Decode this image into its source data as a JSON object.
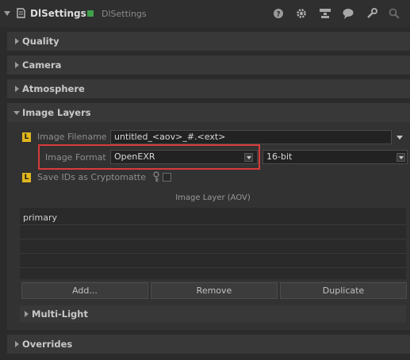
{
  "header": {
    "title": "DlSettings",
    "subtitle": "DlSettings",
    "status_color": "#3fa04a",
    "icons": [
      "help-icon",
      "gear-icon",
      "hierarchy-icon",
      "comment-icon",
      "wrench-icon",
      "search-icon"
    ]
  },
  "sections": {
    "quality": "Quality",
    "camera": "Camera",
    "atmosphere": "Atmosphere",
    "image_layers": "Image Layers",
    "overrides": "Overrides"
  },
  "image_layers": {
    "badge": "L",
    "filename_label": "Image Filename",
    "filename_value": "untitled_<aov>_#.<ext>",
    "format_label": "Image Format",
    "format_value": "OpenEXR",
    "bitdepth_value": "16-bit",
    "cryptomatte_label": "Save IDs as Cryptomatte",
    "aov_header": "Image Layer (AOV)",
    "aov_rows": [
      "primary",
      "",
      "",
      "",
      ""
    ],
    "buttons": {
      "add": "Add...",
      "remove": "Remove",
      "duplicate": "Duplicate"
    },
    "multilight": "Multi-Light"
  }
}
